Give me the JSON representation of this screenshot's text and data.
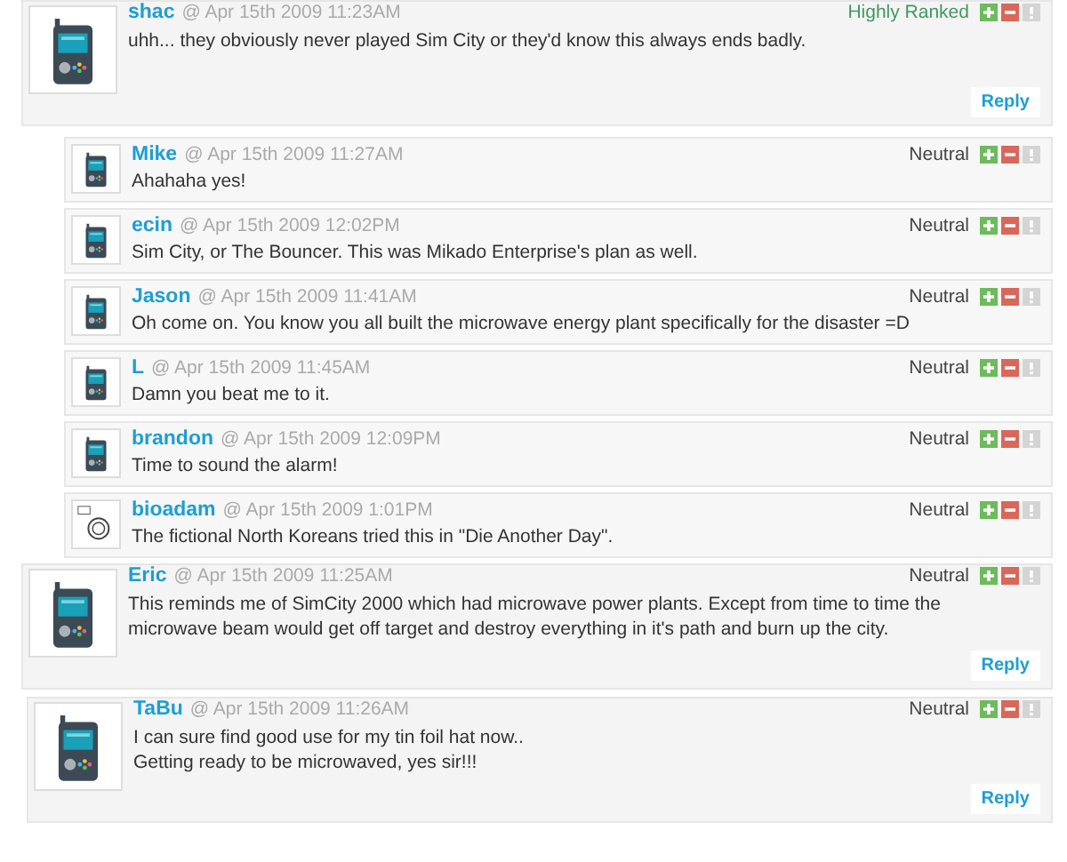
{
  "comments": [
    {
      "author": "shac",
      "date": "@ Apr 15th 2009 11:23AM",
      "rating": {
        "text": "Highly Ranked",
        "kind": "high"
      },
      "avatar": {
        "kind": "device"
      },
      "text": "uhh... they obviously never played Sim City or they'd know this always ends badly.",
      "reply": "Reply",
      "children": [
        {
          "author": "Mike",
          "date": "@ Apr 15th 2009 11:27AM",
          "rating": {
            "text": "Neutral",
            "kind": "neutral"
          },
          "avatar": {
            "kind": "device"
          },
          "text": "Ahahaha yes!"
        },
        {
          "author": "ecin",
          "date": "@ Apr 15th 2009 12:02PM",
          "rating": {
            "text": "Neutral",
            "kind": "neutral"
          },
          "avatar": {
            "kind": "device"
          },
          "text": "Sim City, or The Bouncer. This was Mikado Enterprise's plan as well."
        },
        {
          "author": "Jason",
          "date": "@ Apr 15th 2009 11:41AM",
          "rating": {
            "text": "Neutral",
            "kind": "neutral"
          },
          "avatar": {
            "kind": "device"
          },
          "text": "Oh come on. You know you all built the microwave energy plant specifically for the disaster =D"
        },
        {
          "author": "L",
          "date": "@ Apr 15th 2009 11:45AM",
          "rating": {
            "text": "Neutral",
            "kind": "neutral"
          },
          "avatar": {
            "kind": "device"
          },
          "text": "Damn you beat me to it."
        },
        {
          "author": "brandon",
          "date": "@ Apr 15th 2009 12:09PM",
          "rating": {
            "text": "Neutral",
            "kind": "neutral"
          },
          "avatar": {
            "kind": "device"
          },
          "text": "Time to sound the alarm!"
        },
        {
          "author": "bioadam",
          "date": "@ Apr 15th 2009 1:01PM",
          "rating": {
            "text": "Neutral",
            "kind": "neutral"
          },
          "avatar": {
            "kind": "sketch"
          },
          "text": "The fictional North Koreans tried this in \"Die Another Day\"."
        }
      ]
    },
    {
      "author": "Eric",
      "date": "@ Apr 15th 2009 11:25AM",
      "rating": {
        "text": "Neutral",
        "kind": "neutral"
      },
      "avatar": {
        "kind": "device"
      },
      "text": "This reminds me of SimCity 2000 which had microwave power plants. Except from time to time the microwave beam would get off target and destroy everything in it's path and burn up the city.",
      "reply": "Reply"
    },
    {
      "author": "TaBu",
      "date": "@ Apr 15th 2009 11:26AM",
      "rating": {
        "text": "Neutral",
        "kind": "neutral"
      },
      "avatar": {
        "kind": "device"
      },
      "text": "I can sure find good use for my tin foil hat now..\nGetting ready to be microwaved, yes sir!!!",
      "reply": "Reply"
    }
  ]
}
